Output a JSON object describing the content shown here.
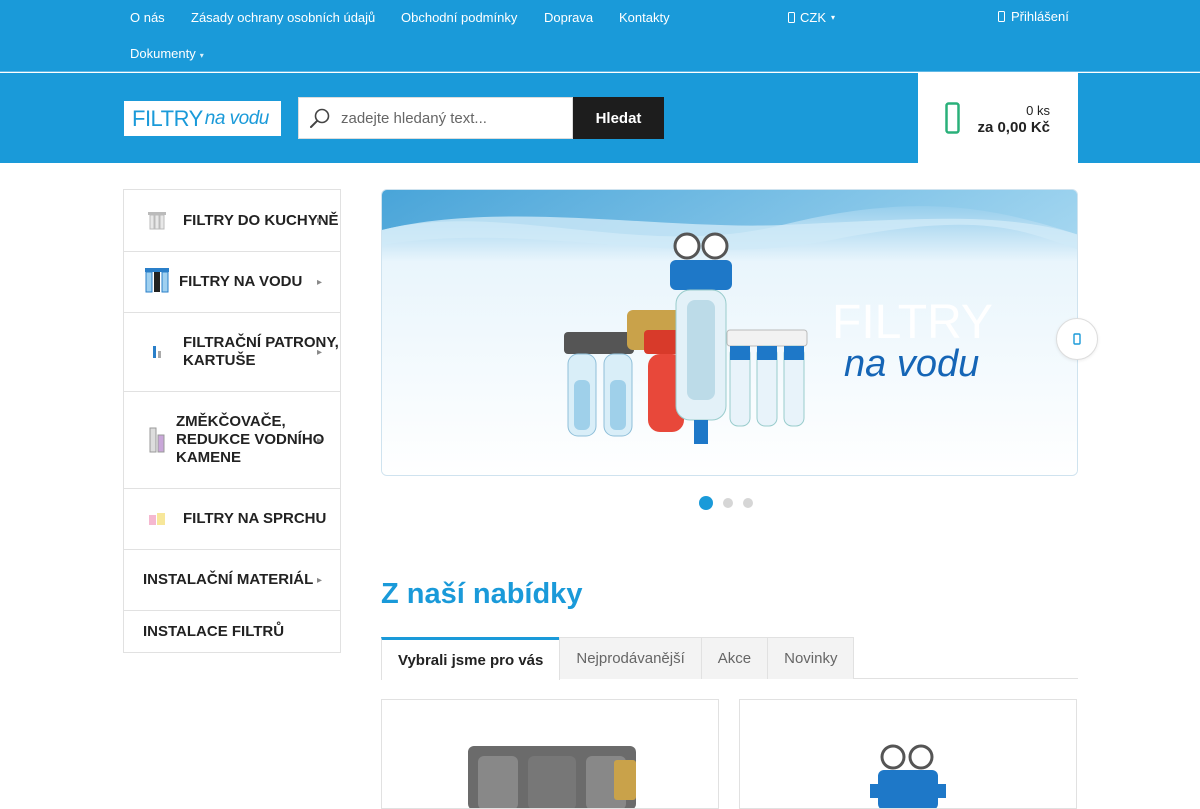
{
  "topbar": {
    "links": [
      "O nás",
      "Zásady ochrany osobních údajů",
      "Obchodní podmínky",
      "Doprava",
      "Kontakty"
    ],
    "documents_label": "Dokumenty",
    "currency": "CZK",
    "login": "Přihlášení"
  },
  "header": {
    "logo_part1": "FILTRY",
    "logo_part2": "na vodu",
    "search_placeholder": "zadejte hledaný text...",
    "search_button": "Hledat",
    "cart_count": "0 ks",
    "cart_total": "za 0,00 Kč"
  },
  "sidebar": {
    "categories": [
      {
        "label": "FILTRY DO KUCHYNĚ",
        "has_submenu": true
      },
      {
        "label": "FILTRY NA VODU",
        "has_submenu": true
      },
      {
        "label": "FILTRAČNÍ PATRONY, KARTUŠE",
        "has_submenu": true
      },
      {
        "label": "ZMĚKČOVAČE, REDUKCE VODNÍHO KAMENE",
        "has_submenu": true
      },
      {
        "label": "FILTRY NA SPRCHU",
        "has_submenu": false
      },
      {
        "label": "INSTALAČNÍ MATERIÁL",
        "has_submenu": true
      },
      {
        "label": "INSTALACE FILTRŮ",
        "has_submenu": false
      }
    ]
  },
  "slider": {
    "headline_1": "FILTRY",
    "headline_2": "na vodu",
    "active_slide": 1,
    "slide_count": 3
  },
  "offer": {
    "title": "Z naší nabídky",
    "tabs": [
      "Vybrali jsme pro vás",
      "Nejprodávanější",
      "Akce",
      "Novinky"
    ],
    "active_tab": 0
  },
  "colors": {
    "brand_blue": "#1a9ad9",
    "dark_button": "#1d1d1d",
    "cart_icon": "#2ab07a"
  }
}
